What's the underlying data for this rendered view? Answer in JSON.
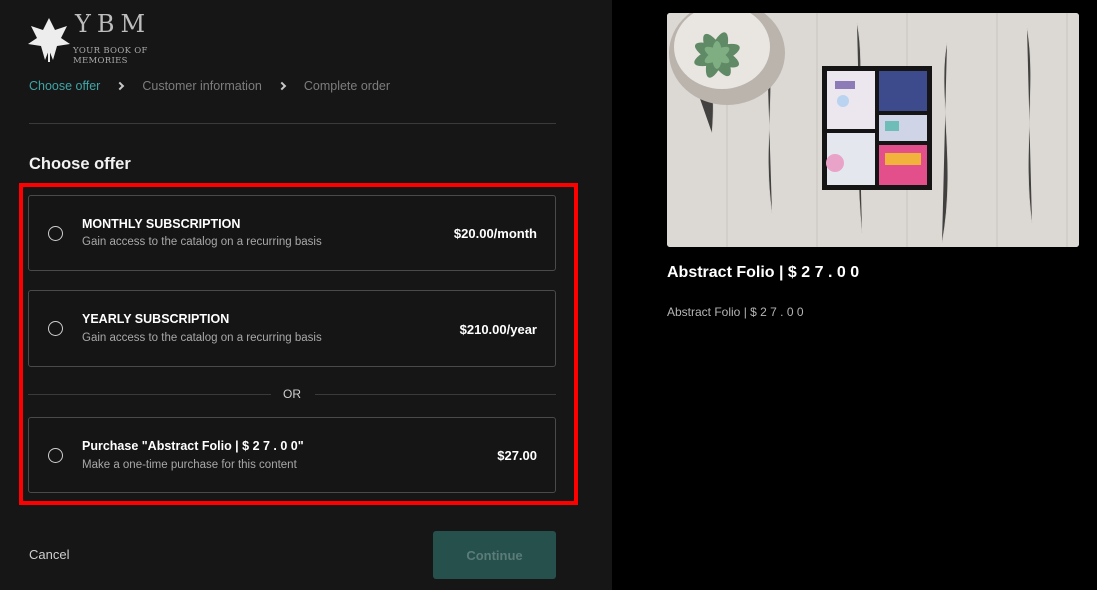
{
  "brand": {
    "name": "YBM",
    "tagline": "YOUR BOOK OF MEMORIES"
  },
  "breadcrumb": [
    {
      "label": "Choose offer",
      "active": true
    },
    {
      "label": "Customer information",
      "active": false
    },
    {
      "label": "Complete order",
      "active": false
    }
  ],
  "section_title": "Choose offer",
  "offers": [
    {
      "name": "MONTHLY SUBSCRIPTION",
      "description": "Gain access to the catalog on a recurring basis",
      "price": "$20.00/month",
      "selected": false
    },
    {
      "name": "YEARLY SUBSCRIPTION",
      "description": "Gain access to the catalog on a recurring basis",
      "price": "$210.00/year",
      "selected": false
    },
    {
      "name": "Purchase \"Abstract Folio | $ 2 7 . 0 0\"",
      "description": "Make a one-time purchase for this content",
      "price": "$27.00",
      "selected": false
    }
  ],
  "or_label": "OR",
  "actions": {
    "cancel": "Cancel",
    "continue": "Continue",
    "continue_disabled": true
  },
  "product": {
    "title": "Abstract Folio | $ 2 7 . 0 0",
    "description": "Abstract Folio | $ 2 7 . 0 0"
  },
  "colors": {
    "accent": "#3fa5a5",
    "highlight": "#ff0000",
    "continue_bg": "#25504c"
  }
}
